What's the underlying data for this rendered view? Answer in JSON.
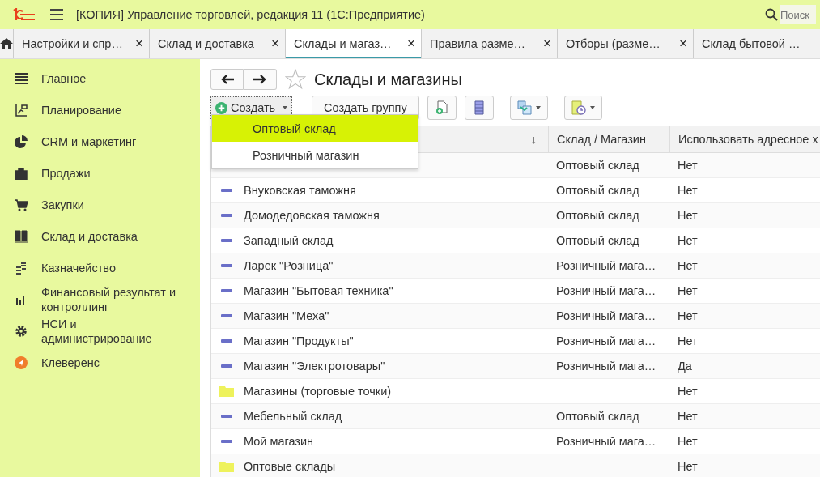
{
  "window": {
    "title": "[КОПИЯ] Управление торговлей, редакция 11  (1С:Предприятие)",
    "search": {
      "placeholder": "Поиск"
    }
  },
  "tabs": [
    {
      "label": "Настройки и спр…",
      "close": "×",
      "selected": false
    },
    {
      "label": "Склад и доставка",
      "close": "×",
      "selected": false
    },
    {
      "label": "Склады и магаз…",
      "close": "×",
      "selected": true
    },
    {
      "label": "Правила разме…",
      "close": "×",
      "selected": false
    },
    {
      "label": "Отборы (разме…",
      "close": "×",
      "selected": false
    },
    {
      "label": "Склад бытовой …",
      "selected": false
    }
  ],
  "sidebar": {
    "items": [
      {
        "label": "Главное"
      },
      {
        "label": "Планирование"
      },
      {
        "label": "CRM и маркетинг"
      },
      {
        "label": "Продажи"
      },
      {
        "label": "Закупки"
      },
      {
        "label": "Склад и доставка"
      },
      {
        "label": "Казначейство"
      },
      {
        "label": "Финансовый результат и контроллинг"
      },
      {
        "label": "НСИ и администрирование"
      },
      {
        "label": "Клеверенс"
      }
    ]
  },
  "page": {
    "title": "Склады и магазины",
    "favorite": false
  },
  "toolbar": {
    "create": "Создать",
    "create_group": "Создать группу"
  },
  "create_menu": [
    {
      "label": "Оптовый склад",
      "selected": true
    },
    {
      "label": "Розничный магазин",
      "selected": false
    }
  ],
  "table": {
    "columns": [
      {
        "sort": "↓"
      },
      {
        "label": "Склад / Магазин"
      },
      {
        "label": "Использовать адресное х"
      }
    ],
    "rows": [
      {
        "type": "Оптовый склад",
        "address": "Нет"
      },
      {
        "kind": "item",
        "name": "Внуковская таможня",
        "type": "Оптовый склад",
        "address": "Нет"
      },
      {
        "kind": "item",
        "name": "Домодедовская таможня",
        "type": "Оптовый склад",
        "address": "Нет"
      },
      {
        "kind": "item",
        "name": "Западный склад",
        "type": "Оптовый склад",
        "address": "Нет"
      },
      {
        "kind": "item",
        "name": "Ларек \"Розница\"",
        "type": "Розничный мага…",
        "address": "Нет"
      },
      {
        "kind": "item",
        "name": "Магазин \"Бытовая техника\"",
        "type": "Розничный мага…",
        "address": "Нет"
      },
      {
        "kind": "item",
        "name": "Магазин \"Меха\"",
        "type": "Розничный мага…",
        "address": "Нет"
      },
      {
        "kind": "item",
        "name": "Магазин \"Продукты\"",
        "type": "Розничный мага…",
        "address": "Нет"
      },
      {
        "kind": "item",
        "name": "Магазин \"Электротовары\"",
        "type": "Розничный мага…",
        "address": "Да"
      },
      {
        "kind": "group",
        "name": "Магазины (торговые точки)",
        "address": "Нет"
      },
      {
        "kind": "item",
        "name": "Мебельный склад",
        "type": "Оптовый склад",
        "address": "Нет"
      },
      {
        "kind": "item",
        "name": "Мой магазин",
        "type": "Розничный мага…",
        "address": "Нет"
      },
      {
        "kind": "group",
        "name": "Оптовые склады",
        "address": "Нет"
      }
    ]
  }
}
